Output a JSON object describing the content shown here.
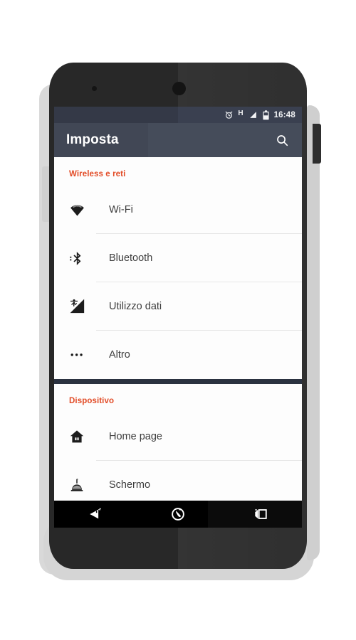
{
  "status_bar": {
    "icons": [
      "alarm-icon",
      "network-type-h",
      "signal-icon",
      "battery-icon"
    ],
    "network_type": "H",
    "time": "16:48"
  },
  "toolbar": {
    "title": "Imposta",
    "search_label": "search-icon"
  },
  "sections": [
    {
      "header": "Wireless e reti",
      "items": [
        {
          "icon": "wifi-icon",
          "label": "Wi-Fi"
        },
        {
          "icon": "bluetooth-icon",
          "label": "Bluetooth"
        },
        {
          "icon": "data-usage-icon",
          "label": "Utilizzo dati"
        },
        {
          "icon": "more-icon",
          "label": "Altro"
        }
      ]
    },
    {
      "header": "Dispositivo",
      "items": [
        {
          "icon": "home-icon",
          "label": "Home page"
        },
        {
          "icon": "display-icon",
          "label": "Schermo"
        }
      ]
    }
  ],
  "nav_bar": {
    "back": "back-icon",
    "home": "home-nav-icon",
    "recents": "recents-icon"
  },
  "colors": {
    "status_bar": "#3a4050",
    "toolbar": "#454c5a",
    "section_header": "#e24b26",
    "card_background": "#fdfdfd",
    "screen_background": "#2b3240",
    "nav_bar": "#000000",
    "phone_body": "#282828",
    "phone_shell": "#d5d5d5"
  }
}
